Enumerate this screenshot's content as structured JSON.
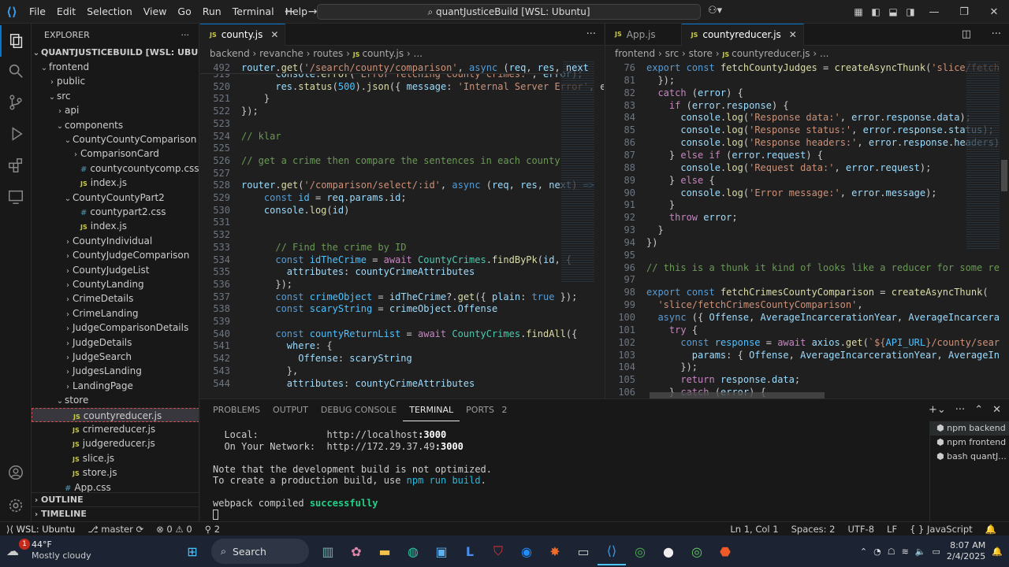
{
  "titlebar": {
    "menus": [
      "File",
      "Edit",
      "Selection",
      "View",
      "Go",
      "Run",
      "Terminal",
      "Help"
    ],
    "command_center": "quantJusticeBuild [WSL: Ubuntu]"
  },
  "sidebar": {
    "title": "EXPLORER",
    "root": "QUANTJUSTICEBUILD [WSL: UBUNTU]",
    "items": [
      {
        "label": "frontend",
        "kind": "folder-open",
        "indent": 1
      },
      {
        "label": "public",
        "kind": "folder",
        "indent": 2
      },
      {
        "label": "src",
        "kind": "folder-open",
        "indent": 2
      },
      {
        "label": "api",
        "kind": "folder",
        "indent": 3
      },
      {
        "label": "components",
        "kind": "folder-open",
        "indent": 3
      },
      {
        "label": "CountyCountyComparison",
        "kind": "folder-open",
        "indent": 4
      },
      {
        "label": "ComparisonCard",
        "kind": "folder",
        "indent": 5
      },
      {
        "label": "countycountycomp.css",
        "kind": "css",
        "indent": 5
      },
      {
        "label": "index.js",
        "kind": "js",
        "indent": 5
      },
      {
        "label": "CountyCountyPart2",
        "kind": "folder-open",
        "indent": 4
      },
      {
        "label": "countypart2.css",
        "kind": "css",
        "indent": 5
      },
      {
        "label": "index.js",
        "kind": "js",
        "indent": 5
      },
      {
        "label": "CountyIndividual",
        "kind": "folder",
        "indent": 4
      },
      {
        "label": "CountyJudgeComparison",
        "kind": "folder",
        "indent": 4
      },
      {
        "label": "CountyJudgeList",
        "kind": "folder",
        "indent": 4
      },
      {
        "label": "CountyLanding",
        "kind": "folder",
        "indent": 4
      },
      {
        "label": "CrimeDetails",
        "kind": "folder",
        "indent": 4
      },
      {
        "label": "CrimeLanding",
        "kind": "folder",
        "indent": 4
      },
      {
        "label": "JudgeComparisonDetails",
        "kind": "folder",
        "indent": 4
      },
      {
        "label": "JudgeDetails",
        "kind": "folder",
        "indent": 4
      },
      {
        "label": "JudgeSearch",
        "kind": "folder",
        "indent": 4
      },
      {
        "label": "JudgesLanding",
        "kind": "folder",
        "indent": 4
      },
      {
        "label": "LandingPage",
        "kind": "folder",
        "indent": 4
      },
      {
        "label": "store",
        "kind": "folder-open",
        "indent": 3
      },
      {
        "label": "countyreducer.js",
        "kind": "js",
        "indent": 4,
        "selected": true
      },
      {
        "label": "crimereducer.js",
        "kind": "js",
        "indent": 4
      },
      {
        "label": "judgereducer.js",
        "kind": "js",
        "indent": 4
      },
      {
        "label": "slice.js",
        "kind": "js",
        "indent": 4
      },
      {
        "label": "store.js",
        "kind": "js",
        "indent": 4
      },
      {
        "label": "App.css",
        "kind": "css",
        "indent": 3
      }
    ],
    "outline": "OUTLINE",
    "timeline": "TIMELINE"
  },
  "editor_left": {
    "tabs": [
      {
        "label": "county.js",
        "active": true
      }
    ],
    "breadcrumbs": [
      "backend",
      "revanche",
      "routes",
      "county.js",
      "..."
    ],
    "sticky": "492    router.get('/search/county/comparison', async (req, res, next",
    "lines": [
      {
        "n": "519",
        "h": "      <span class='v'>console</span>.<span class='f'>error</span>(<span class='s'>'Error fetching county crimes:'</span>, <span class='v'>error</span>);"
      },
      {
        "n": "520",
        "h": "      <span class='v'>res</span>.<span class='f'>status</span>(<span class='n'>500</span>).<span class='f'>json</span>({ <span class='v'>message</span>: <span class='s'>'Internal Server Error'</span>, e"
      },
      {
        "n": "521",
        "h": "    }"
      },
      {
        "n": "522",
        "h": "});"
      },
      {
        "n": "523",
        "h": ""
      },
      {
        "n": "524",
        "h": "<span class='c'>// klar</span>"
      },
      {
        "n": "525",
        "h": ""
      },
      {
        "n": "526",
        "h": "<span class='c'>// get a crime then compare the sentences in each county</span>"
      },
      {
        "n": "527",
        "h": ""
      },
      {
        "n": "528",
        "h": "<span class='v'>router</span>.<span class='f'>get</span>(<span class='s'>'/comparison/select/:id'</span>, <span class='k'>async</span> (<span class='v'>req</span>, <span class='v'>res</span>, <span class='v'>next</span>) <span class='k'>=&gt;</span>"
      },
      {
        "n": "529",
        "h": "    <span class='k'>const</span> <span class='n'>id</span> = <span class='v'>req</span>.<span class='v'>params</span>.<span class='v'>id</span>;"
      },
      {
        "n": "530",
        "h": "    <span class='v'>console</span>.<span class='f'>log</span>(<span class='v'>id</span>)"
      },
      {
        "n": "531",
        "h": ""
      },
      {
        "n": "532",
        "h": ""
      },
      {
        "n": "533",
        "h": "      <span class='c'>// Find the crime by ID</span>"
      },
      {
        "n": "534",
        "h": "      <span class='k'>const</span> <span class='n'>idTheCrime</span> = <span class='kc'>await</span> <span class='ty'>CountyCrimes</span>.<span class='f'>findByPk</span>(<span class='v'>id</span>, {"
      },
      {
        "n": "535",
        "h": "        <span class='v'>attributes</span>: <span class='v'>countyCrimeAttributes</span>"
      },
      {
        "n": "536",
        "h": "      });"
      },
      {
        "n": "537",
        "h": "      <span class='k'>const</span> <span class='n'>crimeObject</span> = <span class='v'>idTheCrime</span>?.<span class='f'>get</span>({ <span class='v'>plain</span>: <span class='k'>true</span> });"
      },
      {
        "n": "538",
        "h": "      <span class='k'>const</span> <span class='n'>scaryString</span> = <span class='v'>crimeObject</span>.<span class='v'>Offense</span>"
      },
      {
        "n": "539",
        "h": ""
      },
      {
        "n": "540",
        "h": "      <span class='k'>const</span> <span class='n'>countyReturnList</span> = <span class='kc'>await</span> <span class='ty'>CountyCrimes</span>.<span class='f'>findAll</span>({"
      },
      {
        "n": "541",
        "h": "        <span class='v'>where</span>: {"
      },
      {
        "n": "542",
        "h": "          <span class='v'>Offense</span>: <span class='v'>scaryString</span>"
      },
      {
        "n": "543",
        "h": "        },"
      },
      {
        "n": "544",
        "h": "        <span class='v'>attributes</span>: <span class='v'>countyCrimeAttributes</span>"
      }
    ]
  },
  "editor_right": {
    "tabs": [
      {
        "label": "App.js",
        "active": false
      },
      {
        "label": "countyreducer.js",
        "active": true
      }
    ],
    "breadcrumbs": [
      "frontend",
      "src",
      "store",
      "countyreducer.js",
      "..."
    ],
    "lines": [
      {
        "n": "76",
        "h": "<span class='k'>export</span> <span class='k'>const</span> <span class='f'>fetchCountyJudges</span> = <span class='f'>createAsyncThunk</span>(<span class='s'>'slice/fetch</span>"
      },
      {
        "n": "81",
        "h": "  });"
      },
      {
        "n": "82",
        "h": "  <span class='kc'>catch</span> (<span class='v'>error</span>) {"
      },
      {
        "n": "83",
        "h": "    <span class='kc'>if</span> (<span class='v'>error</span>.<span class='v'>response</span>) {"
      },
      {
        "n": "84",
        "h": "      <span class='v'>console</span>.<span class='f'>log</span>(<span class='s'>'Response data:'</span>, <span class='v'>error</span>.<span class='v'>response</span>.<span class='v'>data</span>);"
      },
      {
        "n": "85",
        "h": "      <span class='v'>console</span>.<span class='f'>log</span>(<span class='s'>'Response status:'</span>, <span class='v'>error</span>.<span class='v'>response</span>.<span class='v'>status</span>);"
      },
      {
        "n": "86",
        "h": "      <span class='v'>console</span>.<span class='f'>log</span>(<span class='s'>'Response headers:'</span>, <span class='v'>error</span>.<span class='v'>response</span>.<span class='v'>headers</span>)"
      },
      {
        "n": "87",
        "h": "    } <span class='kc'>else if</span> (<span class='v'>error</span>.<span class='v'>request</span>) {"
      },
      {
        "n": "88",
        "h": "      <span class='v'>console</span>.<span class='f'>log</span>(<span class='s'>'Request data:'</span>, <span class='v'>error</span>.<span class='v'>request</span>);"
      },
      {
        "n": "89",
        "h": "    } <span class='kc'>else</span> {"
      },
      {
        "n": "90",
        "h": "      <span class='v'>console</span>.<span class='f'>log</span>(<span class='s'>'Error message:'</span>, <span class='v'>error</span>.<span class='v'>message</span>);"
      },
      {
        "n": "91",
        "h": "    }"
      },
      {
        "n": "92",
        "h": "    <span class='kc'>throw</span> <span class='v'>error</span>;"
      },
      {
        "n": "93",
        "h": "  }"
      },
      {
        "n": "94",
        "h": "})"
      },
      {
        "n": "95",
        "h": ""
      },
      {
        "n": "96",
        "h": "<span class='c'>// this is a thunk it kind of looks like a reducer for some re</span>"
      },
      {
        "n": "97",
        "h": ""
      },
      {
        "n": "98",
        "h": "<span class='k'>export</span> <span class='k'>const</span> <span class='f'>fetchCrimesCountyComparison</span> = <span class='f'>createAsyncThunk</span>("
      },
      {
        "n": "99",
        "h": "  <span class='s'>'slice/fetchCrimesCountyComparison'</span>,"
      },
      {
        "n": "100",
        "h": "  <span class='k'>async</span> ({ <span class='v'>Offense</span>, <span class='v'>AverageIncarcerationYear</span>, <span class='v'>AverageIncarcera</span>"
      },
      {
        "n": "101",
        "h": "    <span class='kc'>try</span> {"
      },
      {
        "n": "102",
        "h": "      <span class='k'>const</span> <span class='n'>response</span> = <span class='kc'>await</span> <span class='v'>axios</span>.<span class='f'>get</span>(<span class='s'>`${</span><span class='n'>API_URL</span><span class='s'>}/county/sear</span>"
      },
      {
        "n": "103",
        "h": "        <span class='v'>params</span>: { <span class='v'>Offense</span>, <span class='v'>AverageIncarcerationYear</span>, <span class='v'>AverageIn</span>"
      },
      {
        "n": "104",
        "h": "      });"
      },
      {
        "n": "105",
        "h": "      <span class='kc'>return</span> <span class='v'>response</span>.<span class='v'>data</span>;"
      },
      {
        "n": "106",
        "h": "    } <span class='kc'>catch</span> (<span class='v'>error</span>) {"
      }
    ]
  },
  "panel": {
    "tabs": [
      "PROBLEMS",
      "OUTPUT",
      "DEBUG CONSOLE",
      "TERMINAL",
      "PORTS"
    ],
    "ports_count": "2",
    "terminal_lines": [
      "  Local:            http://localhost:3000",
      "  On Your Network:  http://172.29.37.49:3000",
      "",
      "Note that the development build is not optimized.",
      "To create a production build, use npm run build.",
      "",
      "webpack compiled successfully",
      ""
    ],
    "terminals": [
      {
        "label": "npm backend"
      },
      {
        "label": "npm frontend"
      },
      {
        "label": "bash quantJ..."
      }
    ]
  },
  "statusbar": {
    "remote": "WSL: Ubuntu",
    "branch": "master",
    "errors": "0",
    "warnings": "0",
    "ports": "2",
    "position": "Ln 1, Col 1",
    "spaces": "Spaces: 2",
    "encoding": "UTF-8",
    "eol": "LF",
    "language": "JavaScript"
  },
  "taskbar": {
    "weather_temp": "44°F",
    "weather_desc": "Mostly cloudy",
    "search": "Search",
    "time": "8:07 AM",
    "date": "2/4/2025",
    "badge": "1"
  }
}
